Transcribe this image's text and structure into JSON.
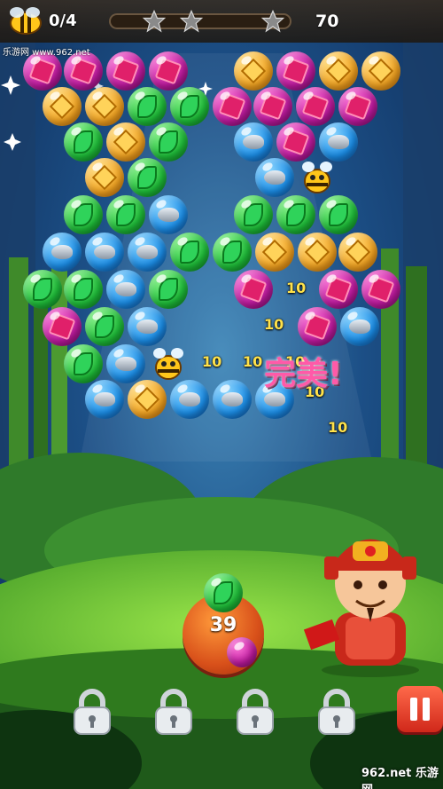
{
  "hud": {
    "bee_counter": "0/4",
    "score": "70",
    "stars_earned": 0,
    "stars_total": 3
  },
  "launcher": {
    "remaining_shots": "39",
    "loaded_bubble": "green",
    "next_bubble": "magenta"
  },
  "popup": {
    "praise": "完美!",
    "points": [
      "10",
      "10",
      "10",
      "10",
      "10",
      "10",
      "10"
    ]
  },
  "locked_boosters": [
    {
      "icon": "padlock-icon"
    },
    {
      "icon": "padlock-icon"
    },
    {
      "icon": "padlock-icon"
    },
    {
      "icon": "padlock-icon"
    }
  ],
  "watermarks": {
    "top": "乐游网 www.962.net",
    "bottom": "962.net 乐游网"
  },
  "bubble_types": {
    "magenta": "gem",
    "gold": "coin",
    "green": "leaf",
    "blue": "rock"
  },
  "board_rows": [
    [
      "magenta",
      "magenta",
      "magenta",
      "magenta",
      "gold",
      "magenta",
      "gold",
      "gold"
    ],
    [
      "gold",
      "gold",
      "green",
      "green",
      "magenta",
      "magenta",
      "magenta",
      "magenta"
    ],
    [
      "green",
      "gold",
      "green",
      "blue",
      "magenta",
      "blue"
    ],
    [
      "gold",
      "green",
      "blue",
      "bee"
    ],
    [
      "green",
      "green",
      "blue",
      "green",
      "green",
      "green"
    ],
    [
      "blue",
      "blue",
      "blue",
      "green",
      "green",
      "gold",
      "gold",
      "gold"
    ],
    [
      "green",
      "green",
      "blue",
      "green",
      "magenta",
      "magenta",
      "magenta"
    ],
    [
      "magenta",
      "green",
      "blue",
      "magenta",
      "blue"
    ],
    [
      "green",
      "blue",
      "bee"
    ],
    [
      "blue",
      "gold",
      "blue",
      "blue",
      "blue"
    ]
  ]
}
